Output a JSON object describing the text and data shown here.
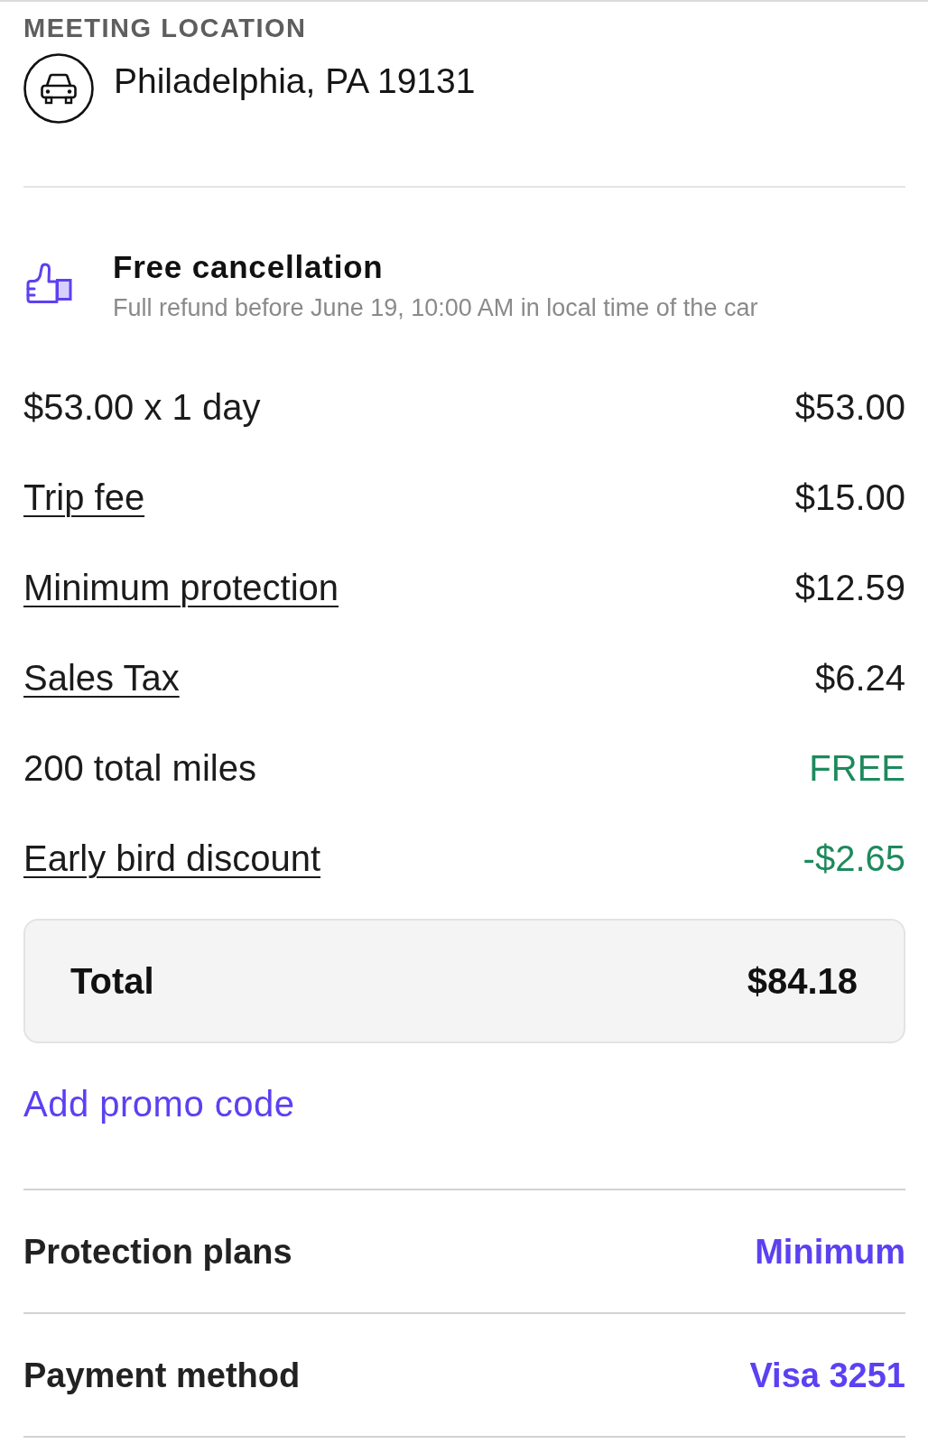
{
  "meeting_location": {
    "label": "MEETING LOCATION",
    "address": "Philadelphia, PA 19131"
  },
  "cancellation": {
    "title": "Free cancellation",
    "detail": "Full refund before June 19, 10:00 AM in local time of the car"
  },
  "price_lines": [
    {
      "label": "$53.00 x 1 day",
      "amount": "$53.00",
      "link": false,
      "kind": "charge"
    },
    {
      "label": "Trip fee",
      "amount": "$15.00",
      "link": true,
      "kind": "charge"
    },
    {
      "label": "Minimum protection",
      "amount": "$12.59",
      "link": true,
      "kind": "charge"
    },
    {
      "label": "Sales Tax",
      "amount": "$6.24",
      "link": true,
      "kind": "charge"
    },
    {
      "label": "200 total miles",
      "amount": "FREE",
      "link": false,
      "kind": "credit"
    },
    {
      "label": "Early bird discount",
      "amount": "-$2.65",
      "link": true,
      "kind": "credit"
    }
  ],
  "total": {
    "label": "Total",
    "amount": "$84.18"
  },
  "promo_link": "Add promo code",
  "settings": [
    {
      "label": "Protection plans",
      "value": "Minimum"
    },
    {
      "label": "Payment method",
      "value": "Visa 3251"
    }
  ]
}
